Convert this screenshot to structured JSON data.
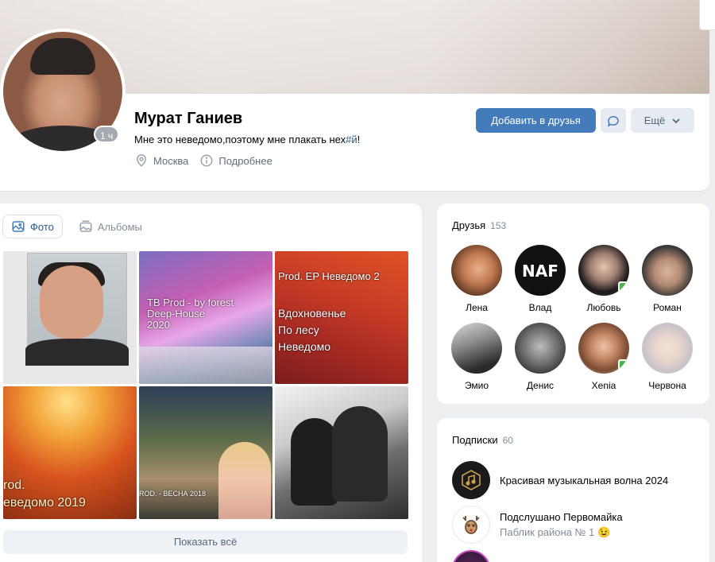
{
  "profile": {
    "name": "Мурат Ганиев",
    "status_text": "Мне это неведомо,поэтому мне плакать нех",
    "status_tag": "#й",
    "status_end": "!",
    "online": "1 ч",
    "city": "Москва",
    "details": "Подробнее"
  },
  "actions": {
    "add_friend": "Добавить в друзья",
    "more": "Ещё"
  },
  "photos": {
    "tabs": [
      {
        "label": "Фото",
        "active": true
      },
      {
        "label": "Альбомы",
        "active": false
      }
    ],
    "captions": {
      "p2_line1": "TB Prod - by forest",
      "p2_line2": "Deep-House",
      "p2_line3": "2020",
      "p3_line1": "Prod. EP Неведомо 2",
      "p3_line2": "Вдохновенье",
      "p3_line3": "По лесу",
      "p3_line4": "Неведомо",
      "p4_line1": "rod.",
      "p4_line2": "еведомо 2019",
      "p5_line1": "ROD. - ВЕСНА 2018"
    },
    "show_all": "Показать всё"
  },
  "friends": {
    "title": "Друзья",
    "count": "153",
    "items": [
      {
        "name": "Лена",
        "mobile": false
      },
      {
        "name": "Влад",
        "mobile": false
      },
      {
        "name": "Любовь",
        "mobile": true
      },
      {
        "name": "Роман",
        "mobile": false
      },
      {
        "name": "Эмио",
        "mobile": false
      },
      {
        "name": "Денис",
        "mobile": false
      },
      {
        "name": "Xenia",
        "mobile": true
      },
      {
        "name": "Червона",
        "mobile": false
      }
    ]
  },
  "subscriptions": {
    "title": "Подписки",
    "count": "60",
    "items": [
      {
        "title": "Красивая музыкальная волна 2024",
        "subtitle": ""
      },
      {
        "title": "Подслушано Первомайка",
        "subtitle": "Паблик района № 1 😉"
      }
    ]
  },
  "colors": {
    "accent": "#447bba",
    "link": "#2a5885",
    "online_mobile": "#4bb34b"
  }
}
